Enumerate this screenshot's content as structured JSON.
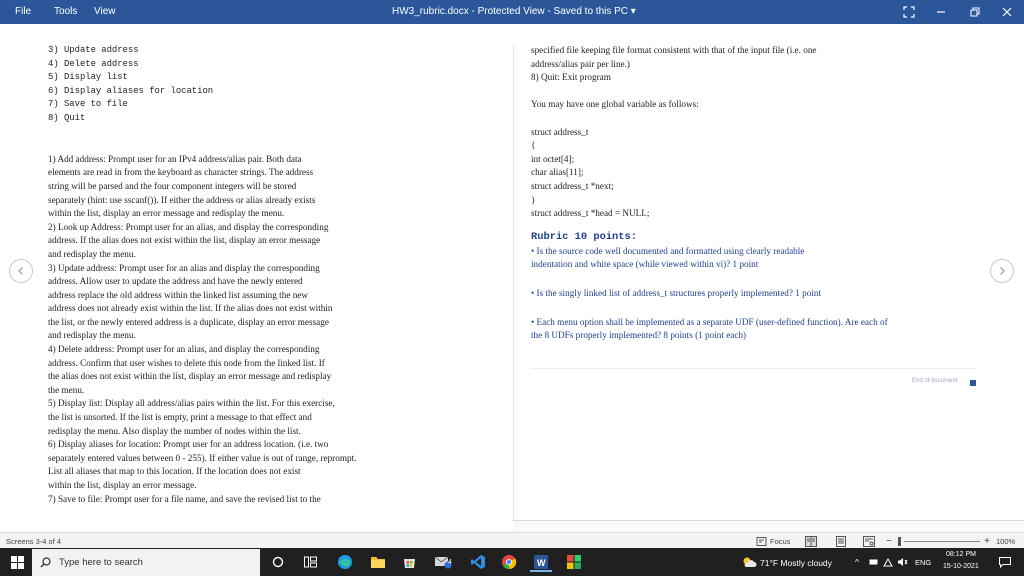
{
  "titlebar": {
    "menu": [
      "File",
      "Tools",
      "View"
    ],
    "doc_title": "HW3_rubric.docx  -  Protected View  -  Saved to this PC  ▾"
  },
  "left_column": [
    {
      "text": "3) Update address",
      "style": "mono"
    },
    {
      "text": "4) Delete address",
      "style": "mono"
    },
    {
      "text": "5) Display list",
      "style": "mono"
    },
    {
      "text": "6) Display aliases for location",
      "style": "mono"
    },
    {
      "text": "7) Save to file",
      "style": "mono"
    },
    {
      "text": "8) Quit",
      "style": "mono"
    },
    {
      "text": "",
      "style": ""
    },
    {
      "text": "",
      "style": ""
    },
    {
      "text": "1) Add address: Prompt user for an IPv4 address/alias pair. Both data",
      "style": ""
    },
    {
      "text": "elements are read in from the keyboard as character strings. The address",
      "style": ""
    },
    {
      "text": "string will be parsed and the four component integers will be stored",
      "style": ""
    },
    {
      "text": "separately (hint: use sscanf()). If either the address or alias already exists",
      "style": ""
    },
    {
      "text": "within the list, display an error message and redisplay the menu.",
      "style": ""
    },
    {
      "text": "2) Look up Address: Prompt user for an alias, and display the corresponding",
      "style": ""
    },
    {
      "text": "address. If the alias does not exist within the list, display an error message",
      "style": ""
    },
    {
      "text": "and redisplay the menu.",
      "style": ""
    },
    {
      "text": "3) Update address: Prompt user for an alias and display the corresponding",
      "style": ""
    },
    {
      "text": "address. Allow user to update the address and have the newly entered",
      "style": ""
    },
    {
      "text": "address replace the old address within the linked list assuming the new",
      "style": ""
    },
    {
      "text": "address does not already exist within the list. If the alias does not exist within",
      "style": ""
    },
    {
      "text": "the list, or the newly entered address is a duplicate, display an error message",
      "style": ""
    },
    {
      "text": "and redisplay the menu.",
      "style": ""
    },
    {
      "text": "4) Delete address: Prompt user for an alias, and display the corresponding",
      "style": ""
    },
    {
      "text": "address. Confirm that user wishes to delete this node from the linked list. If",
      "style": ""
    },
    {
      "text": "the alias does not exist within the list, display an error message and redisplay",
      "style": ""
    },
    {
      "text": "the menu.",
      "style": ""
    },
    {
      "text": "5) Display list: Display all address/alias pairs within the list. For this exercise,",
      "style": ""
    },
    {
      "text": "the list is unsorted. If the list is empty, print a message to that effect and",
      "style": ""
    },
    {
      "text": "redisplay the menu. Also display the number of nodes within the list.",
      "style": ""
    },
    {
      "text": "6) Display aliases for location: Prompt user for an address location. (i.e. two",
      "style": ""
    },
    {
      "text": "separately entered values between 0 - 255). If either value is out of range, reprompt.",
      "style": ""
    },
    {
      "text": "List all aliases that map to this location. If the location does not exist",
      "style": ""
    },
    {
      "text": "within the list, display an error message.",
      "style": ""
    },
    {
      "text": "7) Save to file: Prompt user for a file name, and save the revised list to the",
      "style": ""
    }
  ],
  "right_column": {
    "intro": [
      "specified file keeping file format consistent with that of the input file (i.e. one",
      "address/alias pair per line.)",
      "8) Quit: Exit program"
    ],
    "global_note": "You may have one global variable as follows:",
    "code": [
      "struct address_t",
      "{",
      "int octet[4];",
      "char alias[11];",
      "struct address_t *next;",
      "}",
      "struct address_t *head = NULL;"
    ],
    "rubric_title": "Rubric 10 points:",
    "rubric_items": [
      [
        "• Is the source code well documented and formatted using clearly readable",
        "indentation and white space (while viewed within vi)? 1 point"
      ],
      [
        "• Is the singly linked list of address_t structures properly implemented? 1 point"
      ],
      [
        "• Each menu option shall be implemented as a separate UDF (user-defined function). Are each of",
        "the 8 UDFs properly implemented? 8 points (1 point each)"
      ]
    ],
    "end_of_document": "End of document"
  },
  "statusbar": {
    "screens": "Screens 3-4 of 4",
    "focus": "Focus",
    "zoom": "100%"
  },
  "taskbar": {
    "search_placeholder": "Type here to search",
    "mail_badge": "4",
    "weather": "71°F  Mostly cloudy",
    "lang": "ENG",
    "time": "08:12 PM",
    "date": "15-10-2021"
  },
  "colors": {
    "title_bar": "#2b579a",
    "taskbar": "#202020",
    "rubric_blue": "#1f3f8f"
  }
}
